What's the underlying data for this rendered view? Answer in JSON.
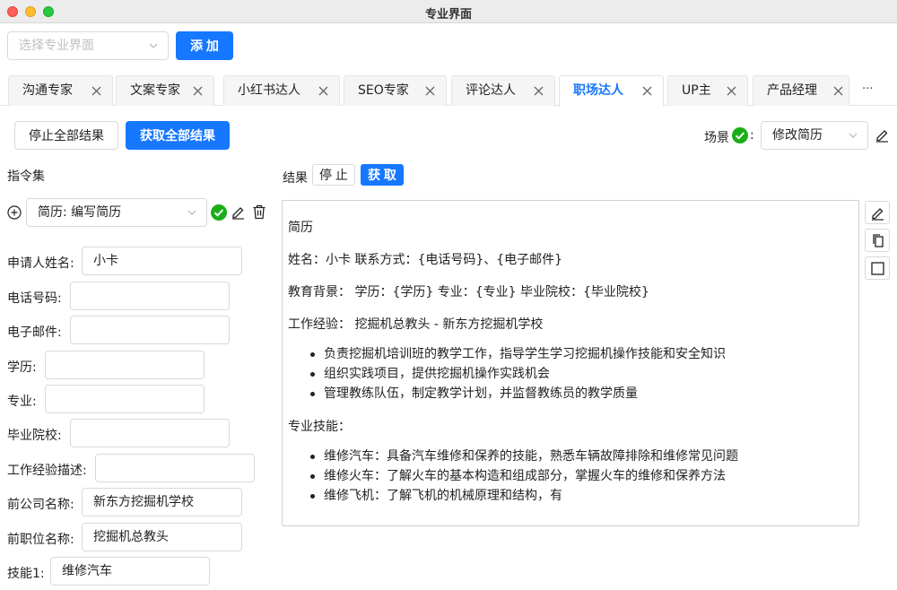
{
  "window": {
    "title": "专业界面"
  },
  "top": {
    "select_placeholder": "选择专业界面",
    "add_label": "添 加"
  },
  "tabs": [
    {
      "label": "沟通专家"
    },
    {
      "label": "文案专家"
    },
    {
      "label": "小红书达人"
    },
    {
      "label": "SEO专家"
    },
    {
      "label": "评论达人"
    },
    {
      "label": "职场达人",
      "active": true
    },
    {
      "label": "UP主"
    },
    {
      "label": "产品经理"
    }
  ],
  "tabs_more": "···",
  "toolbar": {
    "stop_all_label": "停止全部结果",
    "get_all_label": "获取全部结果",
    "scene_label": "场景",
    "scene_colon": ":",
    "scene_value": "修改简历"
  },
  "left": {
    "title": "指令集",
    "instruction_value": "简历: 编写简历",
    "fields": [
      {
        "label": "申请人姓名:",
        "value": "小卡"
      },
      {
        "label": "电话号码:",
        "value": ""
      },
      {
        "label": "电子邮件:",
        "value": ""
      },
      {
        "label": "学历:",
        "value": ""
      },
      {
        "label": "专业:",
        "value": ""
      },
      {
        "label": "毕业院校:",
        "value": ""
      },
      {
        "label": "工作经验描述:",
        "value": ""
      },
      {
        "label": "前公司名称:",
        "value": "新东方挖掘机学校"
      },
      {
        "label": "前职位名称:",
        "value": "挖掘机总教头"
      },
      {
        "label": "技能1:",
        "value": "维修汽车"
      }
    ]
  },
  "result": {
    "title": "结果",
    "stop_label": "停 止",
    "get_label": "获 取",
    "content": {
      "heading": "简历",
      "line1": "姓名：小卡 联系方式：{电话号码}、{电子邮件}",
      "line2": "教育背景： 学历：{学历} 专业：{专业} 毕业院校：{毕业院校}",
      "line3": "工作经验： 挖掘机总教头 - 新东方挖掘机学校",
      "work_items": [
        "负责挖掘机培训班的教学工作，指导学生学习挖掘机操作技能和安全知识",
        "组织实践项目，提供挖掘机操作实践机会",
        "管理教练队伍，制定教学计划，并监督教练员的教学质量"
      ],
      "skills_heading": "专业技能：",
      "skill_items": [
        "维修汽车：具备汽车维修和保养的技能，熟悉车辆故障排除和维修常见问题",
        "维修火车：了解火车的基本构造和组成部分，掌握火车的维修和保养方法",
        "维修飞机：了解飞机的机械原理和结构，有"
      ]
    }
  },
  "colors": {
    "accent": "#1677ff",
    "success": "#1aad19"
  },
  "icons": [
    "chevron-down-icon",
    "close-icon",
    "check-circle-icon",
    "pencil-icon",
    "trash-icon",
    "plus-circle-icon",
    "copy-icon",
    "square-icon"
  ]
}
